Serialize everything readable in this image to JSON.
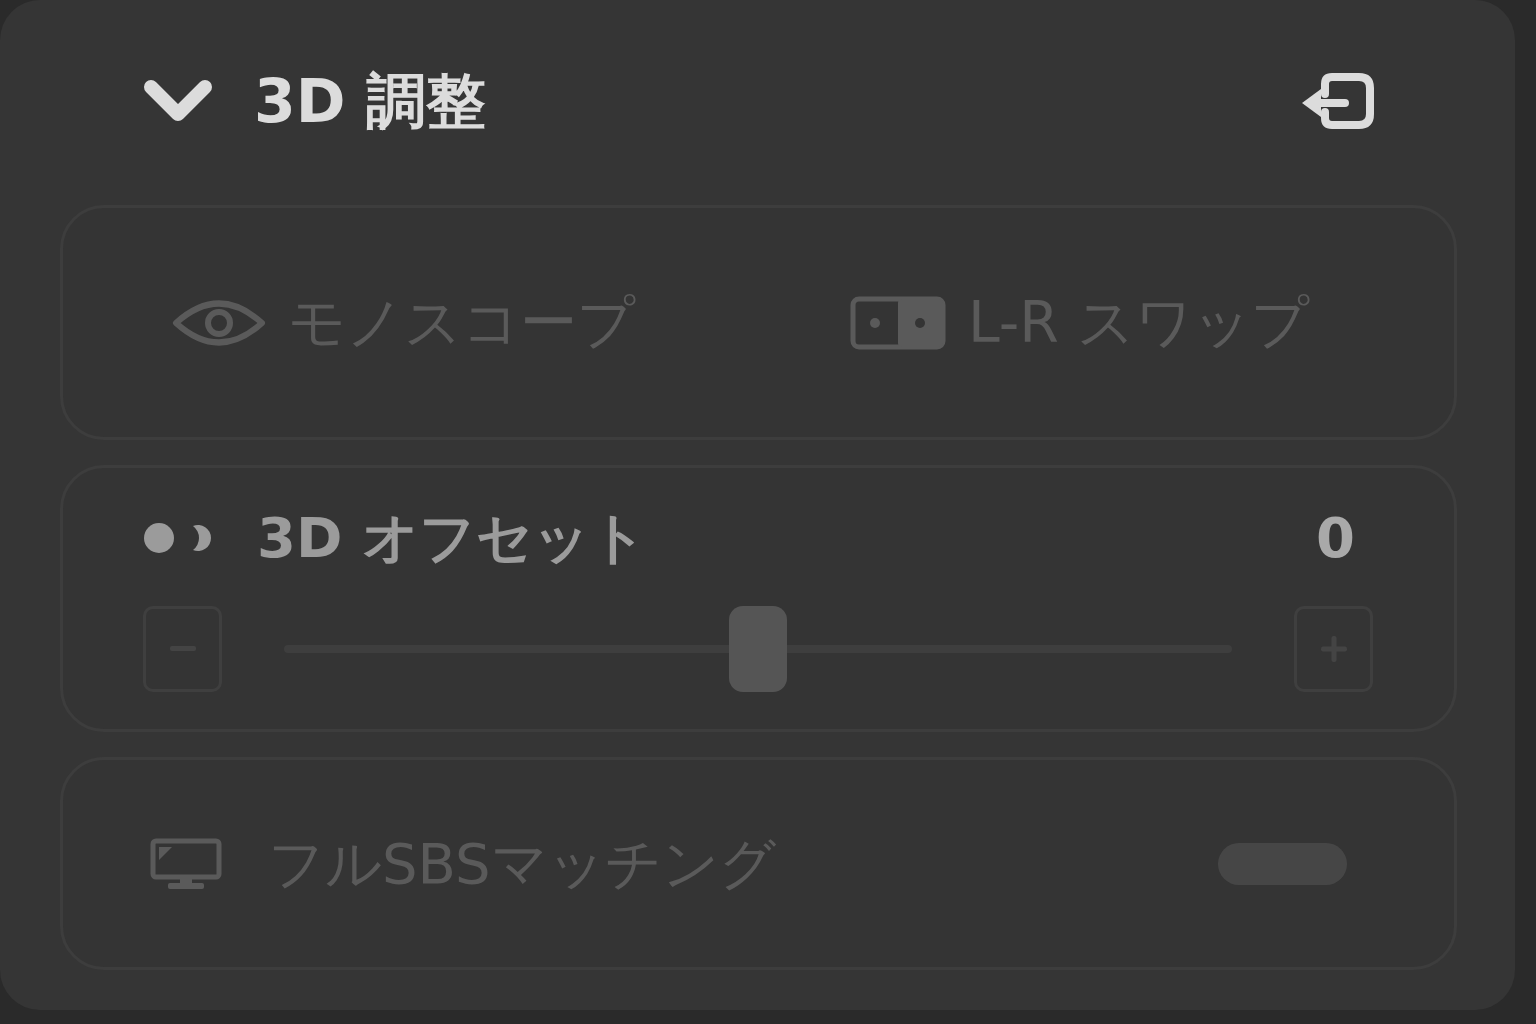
{
  "panel": {
    "title": "3D 調整",
    "expanded": true
  },
  "view_options": {
    "disabled": true,
    "buttons": [
      {
        "kind": "monoscope",
        "label": "モノスコープ"
      },
      {
        "kind": "swap",
        "label": "L-R スワップ"
      }
    ]
  },
  "offset": {
    "label": "3D オフセット",
    "value": "0",
    "level": 0.5
  },
  "full_sbs": {
    "label": "フルSBSマッチング",
    "on": false,
    "disabled": true
  }
}
